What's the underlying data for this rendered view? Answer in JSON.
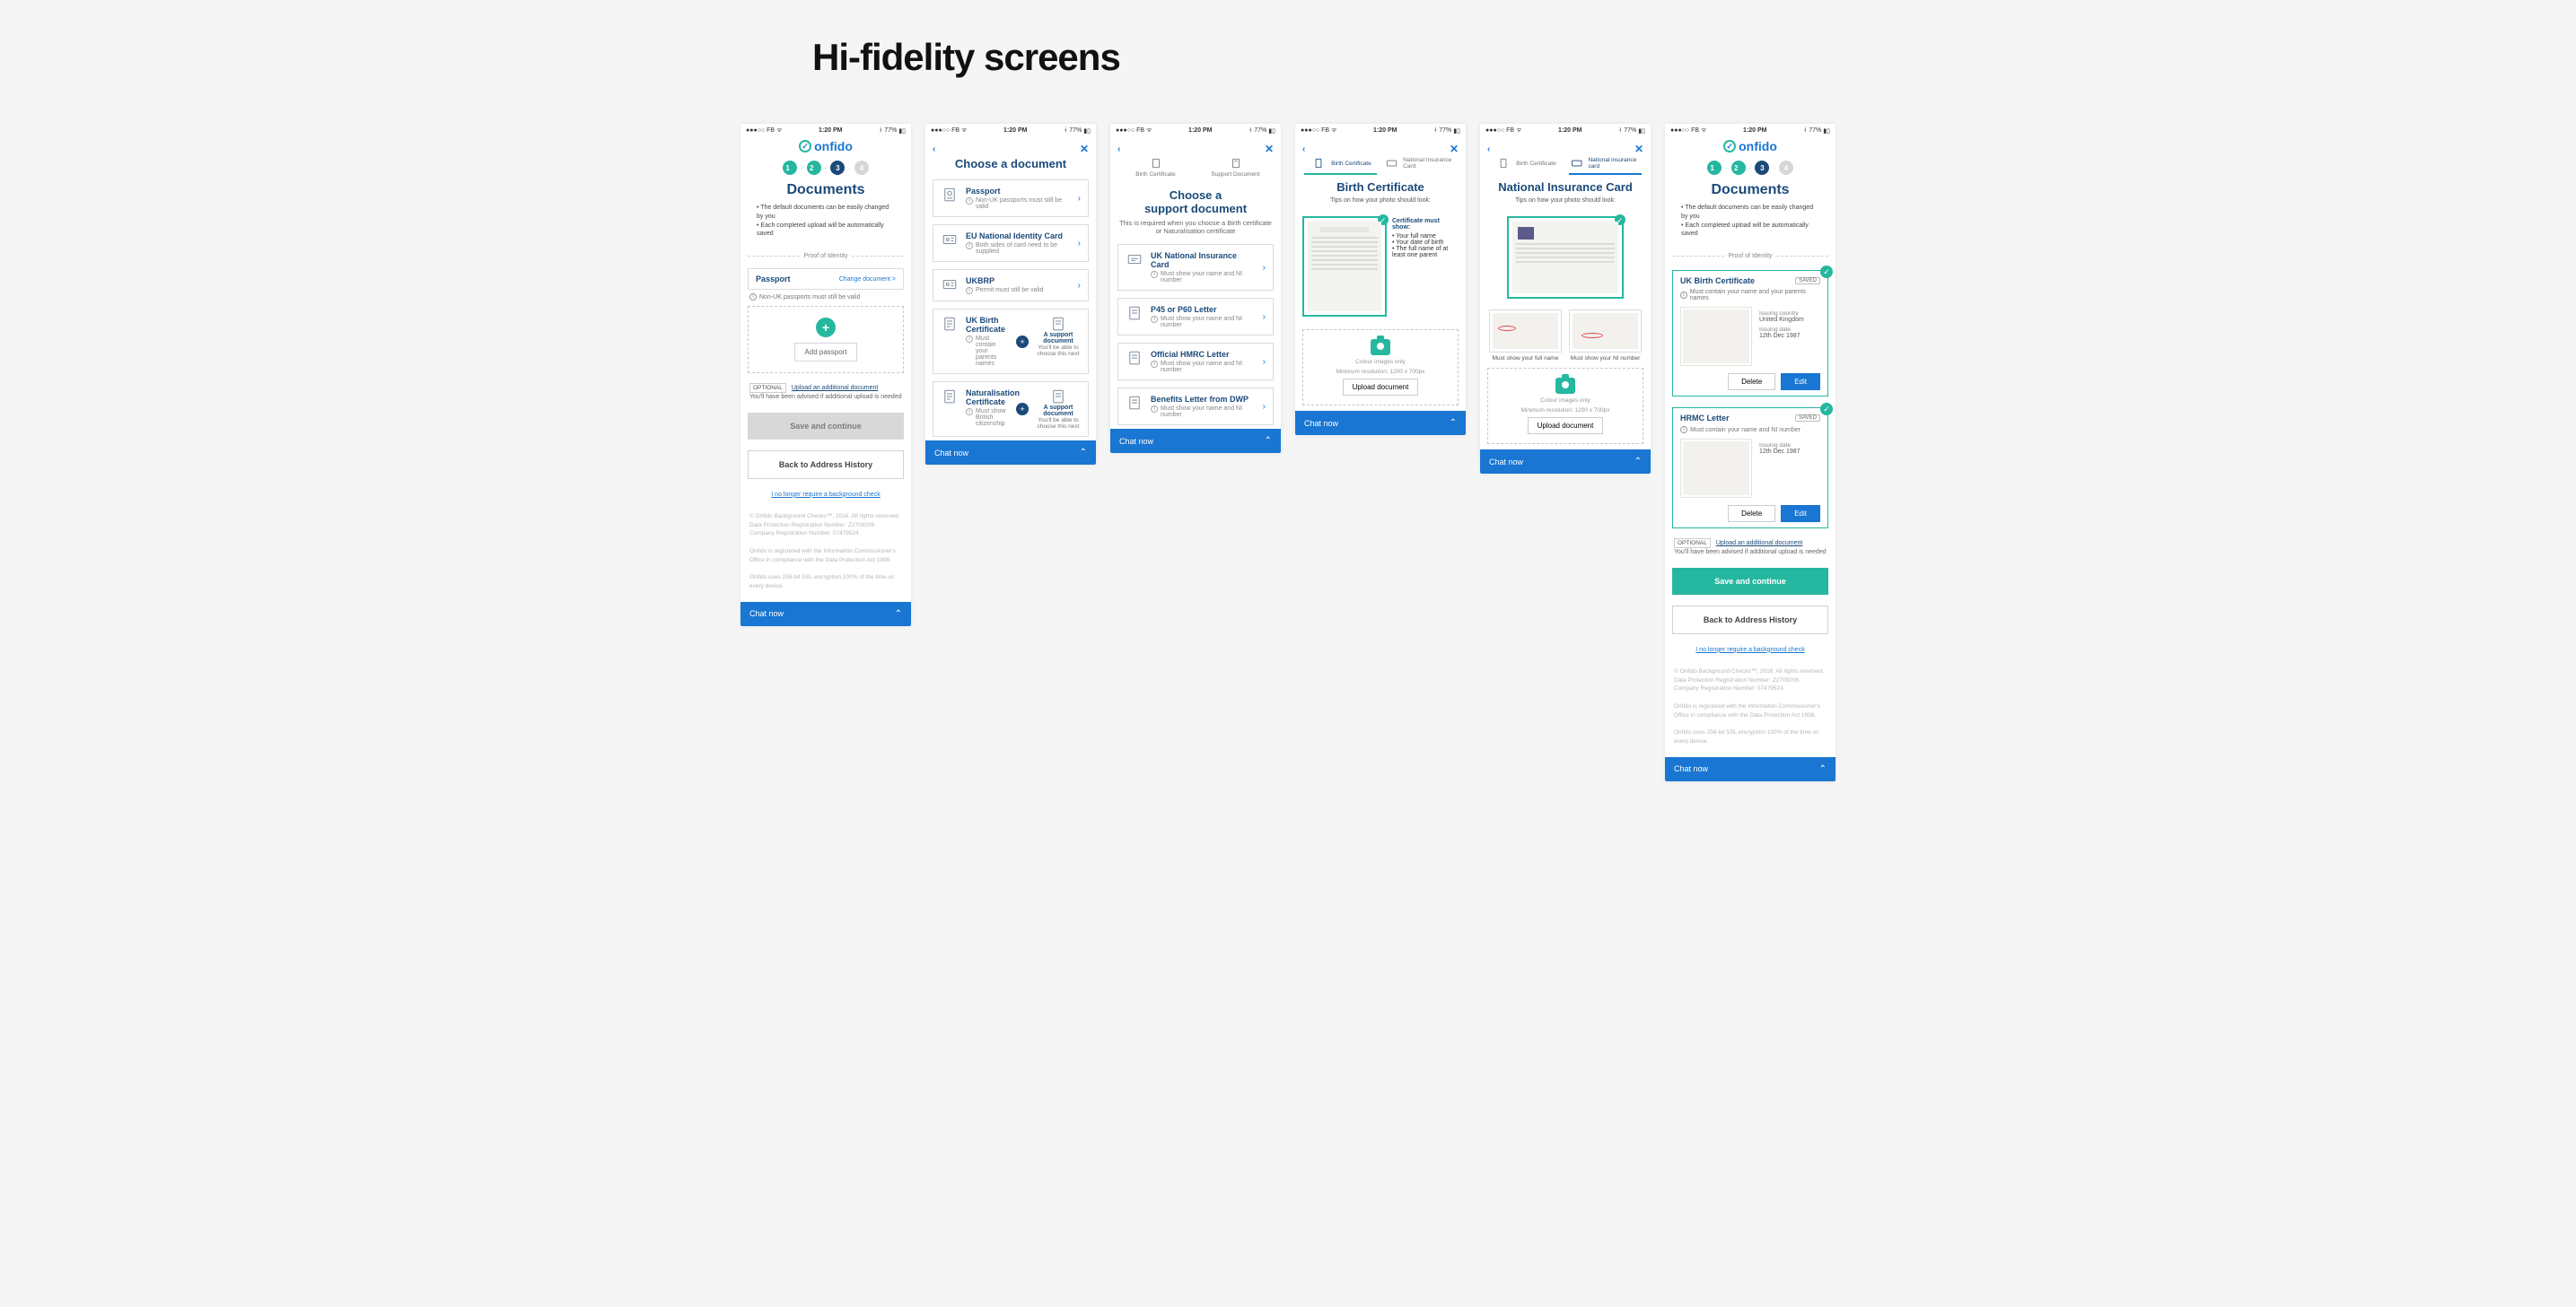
{
  "page_heading": "Hi-fidelity screens",
  "status": {
    "carrier": "FB",
    "time": "1:20 PM",
    "battery": "77%"
  },
  "logo": "onfido",
  "chat": "Chat now",
  "common": {
    "steps": [
      "1",
      "2",
      "3",
      "4"
    ],
    "documents_title": "Documents",
    "intro_1": "The default documents can be easily changed by you",
    "intro_2": "Each completed upload will be automatically saved",
    "divider_identity": "Proof of Identity",
    "save_continue": "Save and continue",
    "back_address": "Back to Address History",
    "cancel_link": "I no longer require a background check",
    "optional_tag": "OPTIONAL",
    "upload_additional": "Upload an additional document",
    "upload_additional_sub": "You'll have been advised if additional upload is needed",
    "footer_1": "© Onfido Background Checks™, 2016. All rights reserved. Data Protection Registration Number: Z2709206. Company Registration Number: 07479524.",
    "footer_2": "Onfido is registered with the Information Commissioner's Office in compliance with the Data Protection Act 1998.",
    "footer_3": "Onfido uses 256-bit SSL encryption 100% of the time on every device."
  },
  "s1": {
    "passport_title": "Passport",
    "change_doc": "Change document >",
    "passport_hint": "Non-UK passports must still be valid",
    "add_passport": "Add passport"
  },
  "s2": {
    "title": "Choose a document",
    "rows": [
      {
        "title": "Passport",
        "sub": "Non-UK passports must still be valid",
        "icon": "passport"
      },
      {
        "title": "EU National Identity Card",
        "sub": "Both sides of card need to be supplied",
        "icon": "idcard"
      },
      {
        "title": "UKBRP",
        "sub": "Permit must still be valid",
        "icon": "idcard"
      }
    ],
    "pair1": {
      "title": "UK Birth Certificate",
      "sub": "Must contain your parents names",
      "support_t": "A support document",
      "support_s": "You'll be able to choose this next"
    },
    "pair2": {
      "title": "Naturalisation Certificate",
      "sub": "Must show British citizenship",
      "support_t": "A support document",
      "support_s": "You'll be able to choose this next"
    }
  },
  "s3": {
    "title_1": "Choose a",
    "title_2": "support document",
    "sub": "This is required when you choose a Birth certificate or Naturalisation certificate",
    "tabs": {
      "birth": "Birth Certificate",
      "support": "Support Document"
    },
    "rows": [
      {
        "title": "UK National Insurance Card",
        "sub": "Must show your name and NI number"
      },
      {
        "title": "P45 or P60 Letter",
        "sub": "Must show your name and NI number"
      },
      {
        "title": "Official HMRC Letter",
        "sub": "Must show your name and NI number"
      },
      {
        "title": "Benefits Letter from DWP",
        "sub": "Must show your name and NI number"
      }
    ]
  },
  "s4": {
    "title": "Birth Certificate",
    "tips": "Tips on how your photo should look:",
    "tabs": {
      "birth": "Birth Certificate",
      "ni": "National Insurance Card"
    },
    "must_show": "Certificate must show:",
    "bullets": [
      "Your full name",
      "Your date of birth",
      "The full name of at least one parent"
    ],
    "u_note1": "Colour images only",
    "u_note2": "Minimum resolution: 1200 x 700px",
    "upload_btn": "Upload document"
  },
  "s5": {
    "title": "National Insurance Card",
    "tips": "Tips on how your photo should look:",
    "tabs": {
      "birth": "Birth Certificate",
      "ni": "National insurance card"
    },
    "cap1": "Must show your full name",
    "cap2": "Must show your NI number",
    "u_note1": "Colour images only",
    "u_note2": "Minimum resolution: 1200 x 700px",
    "upload_btn": "Upload document"
  },
  "s6": {
    "c1": {
      "title": "UK Birth Certificate",
      "saved": "SAVED",
      "hint": "Must contain your name and your parents names",
      "k1": "Issuing country",
      "v1": "United Kingdom",
      "k2": "Issuing date",
      "v2": "12th Dec 1987"
    },
    "c2": {
      "title": "HRMC Letter",
      "saved": "SAVED",
      "hint": "Must contain your name and NI number",
      "k2": "Issuing date",
      "v2": "12th Dec 1987"
    },
    "delete": "Delete",
    "edit": "Edit"
  }
}
